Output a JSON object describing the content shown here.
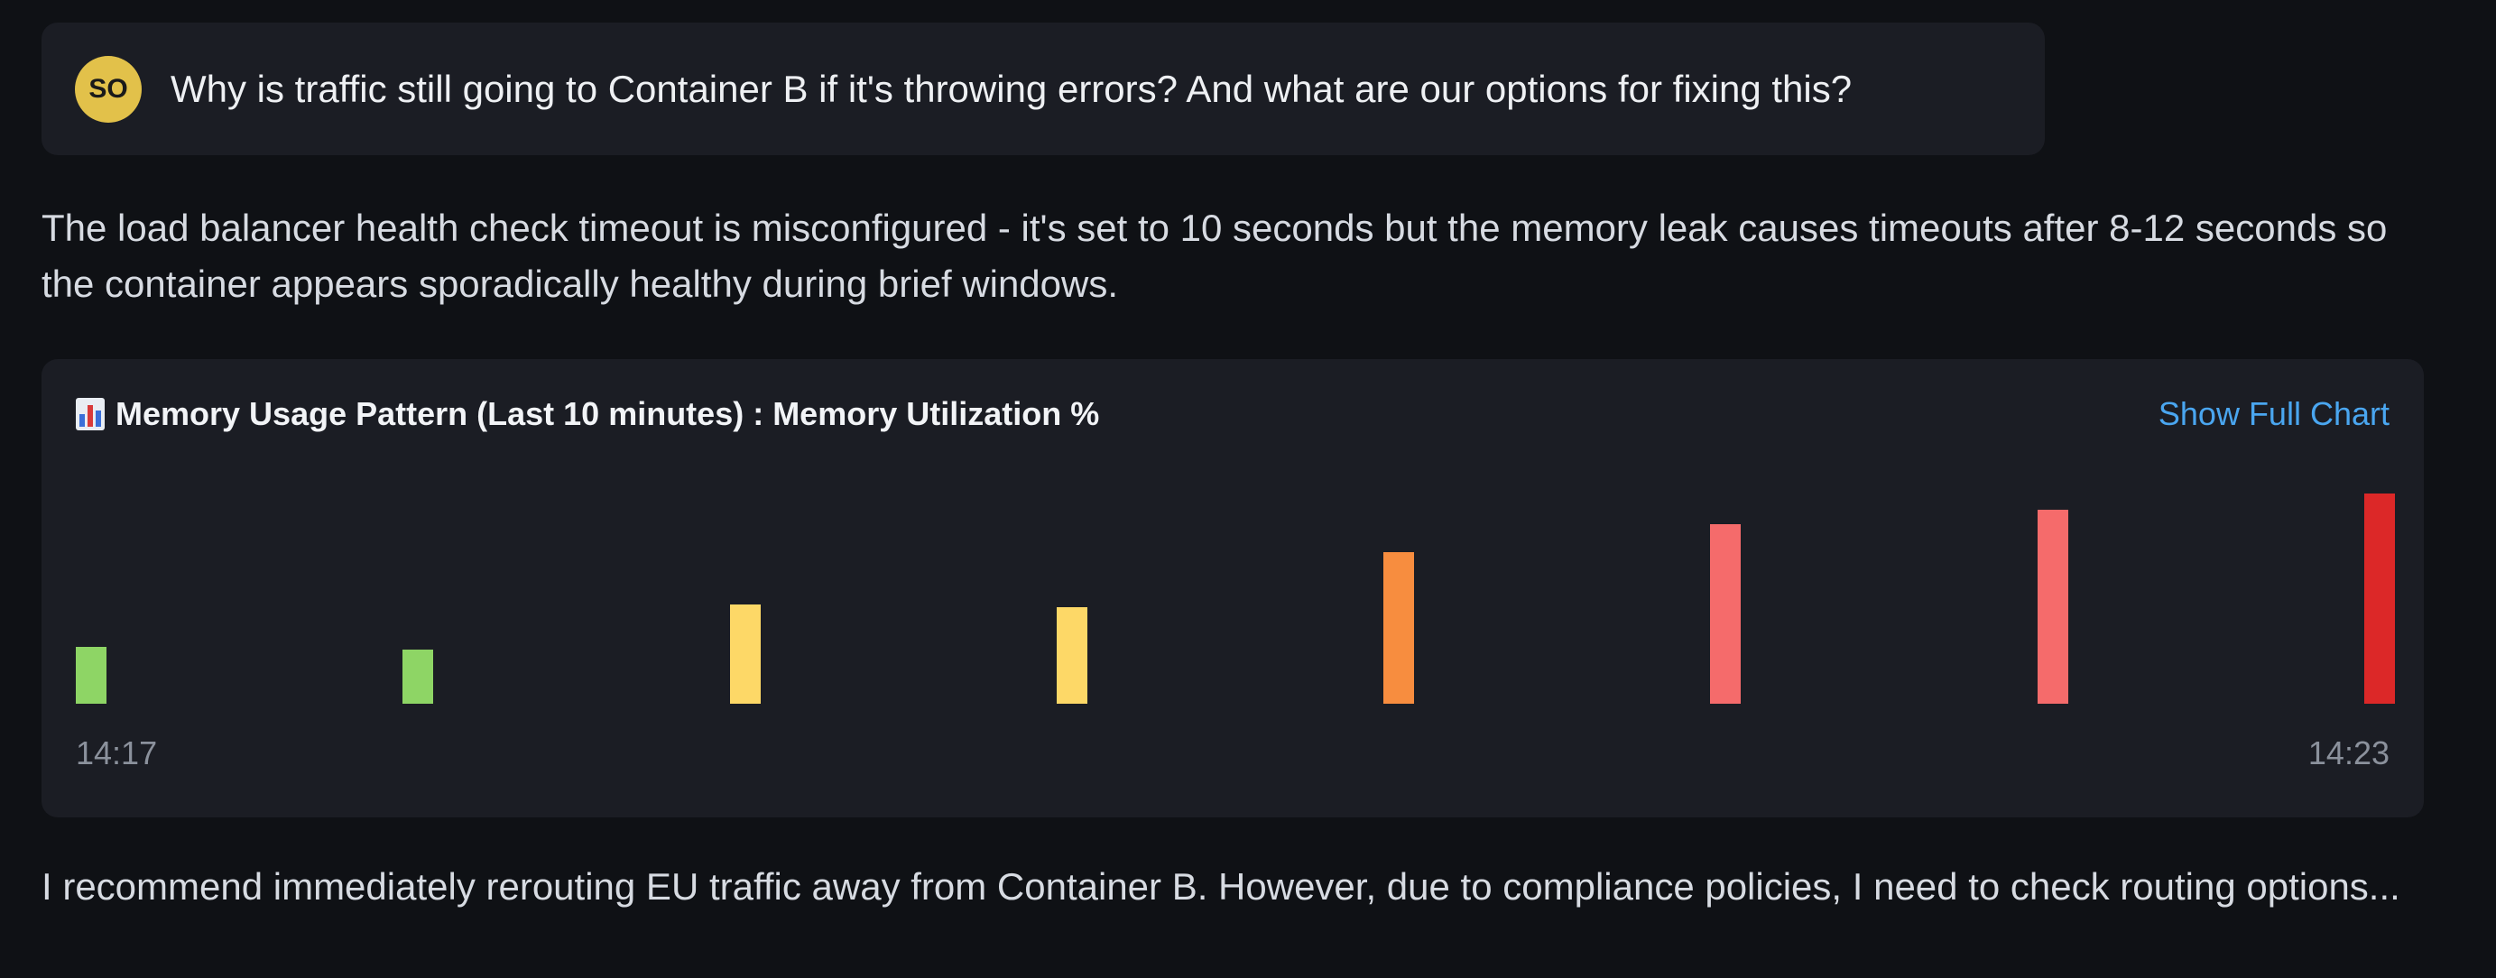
{
  "user_message": {
    "avatar_initials": "SO",
    "text": "Why is traffic still going to Container B if it's throwing errors? And what are our options for fixing this?"
  },
  "assistant_paragraph_1": "The load balancer health check timeout is misconfigured - it's set to 10 seconds but the memory leak causes timeouts after 8-12 seconds so the container appears sporadically healthy during brief windows.",
  "chart_card": {
    "title": "Memory Usage Pattern (Last 10 minutes) : Memory Utilization %",
    "show_full_chart_label": "Show Full Chart",
    "icon": "bar-chart-icon"
  },
  "chart_data": {
    "type": "bar",
    "title": "Memory Usage Pattern (Last 10 minutes) : Memory Utilization %",
    "x_start_label": "14:17",
    "x_end_label": "14:23",
    "ylim": [
      0,
      100
    ],
    "values": [
      24,
      23,
      42,
      41,
      64,
      76,
      82,
      89
    ],
    "colors": [
      "#8ed565",
      "#8ed565",
      "#fdd867",
      "#fdd867",
      "#f78d3f",
      "#f56b6b",
      "#f56b6b",
      "#dc2828"
    ]
  },
  "assistant_paragraph_2": "I recommend immediately rerouting EU traffic away from Container B. However, due to compliance policies, I need to check routing options..."
}
